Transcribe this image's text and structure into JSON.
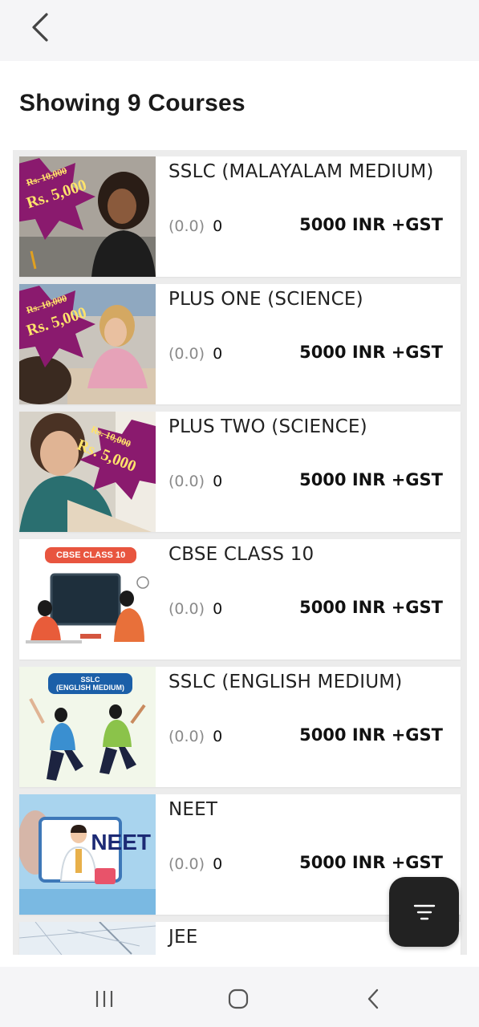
{
  "header": {
    "back_icon": "chevron-left-icon",
    "title": "Showing 9 Courses"
  },
  "courses": [
    {
      "title": "SSLC (MALAYALAM MEDIUM)",
      "rating": "(0.0)",
      "count": "0",
      "price": "5000 INR +GST",
      "thumb": {
        "old_price": "Rs. 10,000",
        "new_price": "Rs. 5,000"
      }
    },
    {
      "title": "PLUS ONE (SCIENCE)",
      "rating": "(0.0)",
      "count": "0",
      "price": "5000 INR +GST",
      "thumb": {
        "old_price": "Rs. 10,000",
        "new_price": "Rs. 5,000"
      }
    },
    {
      "title": "PLUS TWO (SCIENCE)",
      "rating": "(0.0)",
      "count": "0",
      "price": "5000 INR +GST",
      "thumb": {
        "old_price": "Rs. 10,000",
        "new_price": "Rs. 5,000"
      }
    },
    {
      "title": "CBSE CLASS 10",
      "rating": "(0.0)",
      "count": "0",
      "price": "5000 INR +GST",
      "thumb": {
        "tag": "CBSE CLASS 10"
      }
    },
    {
      "title": "SSLC (ENGLISH MEDIUM)",
      "rating": "(0.0)",
      "count": "0",
      "price": "5000 INR +GST",
      "thumb": {
        "tag": "SSLC\n(ENGLISH MEDIUM)"
      }
    },
    {
      "title": "NEET",
      "rating": "(0.0)",
      "count": "0",
      "price": "5000 INR +GST",
      "thumb": {
        "label": "NEET"
      }
    },
    {
      "title": "JEE"
    }
  ],
  "fab": {
    "icon": "filter-icon"
  },
  "system_nav": {
    "recents_icon": "recents-icon",
    "home_icon": "home-icon",
    "back_icon": "back-icon"
  },
  "colors": {
    "header_bg": "#f5f5f7",
    "list_bg": "#ececec",
    "fab_bg": "#222222",
    "promo_purple": "#8a1a6e",
    "promo_yellow": "#ffe36b",
    "tag_orange": "#e8553f",
    "tag_blue": "#1b5fa8"
  }
}
